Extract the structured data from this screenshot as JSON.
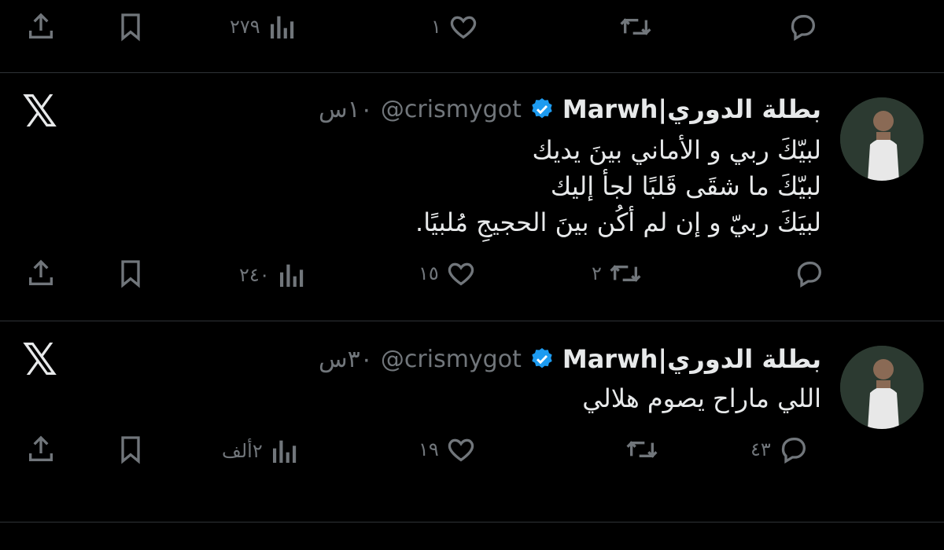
{
  "colors": {
    "background": "#000000",
    "text": "#e7e9ea",
    "muted": "#71767b",
    "verified": "#1d9bf0",
    "divider": "#2f3336"
  },
  "top_actions": {
    "views": "٢٧٩",
    "likes": "١",
    "retweets": "",
    "replies": ""
  },
  "tweets": [
    {
      "display_name": "بطلة الدوري|Marwh",
      "handle": "@crismygot",
      "time": "١٠س",
      "lines": [
        "لبيّكَ ربي و الأماني بينَ يديك",
        "لبيّكَ ما شقَى قَلبًا لجأ إليك",
        "لبيَكَ ربيّ و إن لم أكُن بينَ الحجيجِ مُلبيًا."
      ],
      "views": "٢٤٠",
      "likes": "١٥",
      "retweets": "٢",
      "replies": ""
    },
    {
      "display_name": "بطلة الدوري|Marwh",
      "handle": "@crismygot",
      "time": "٣٠س",
      "lines": [
        "اللي ماراح يصوم هلالي"
      ],
      "views": "٢ألف",
      "likes": "١٩",
      "retweets": "",
      "replies": "٤٣"
    }
  ],
  "icons": {
    "share": "share-icon",
    "bookmark": "bookmark-icon",
    "views": "views-icon",
    "like": "heart-icon",
    "retweet": "retweet-icon",
    "reply": "reply-icon",
    "brand": "x-logo-icon",
    "verified": "verified-badge-icon"
  }
}
